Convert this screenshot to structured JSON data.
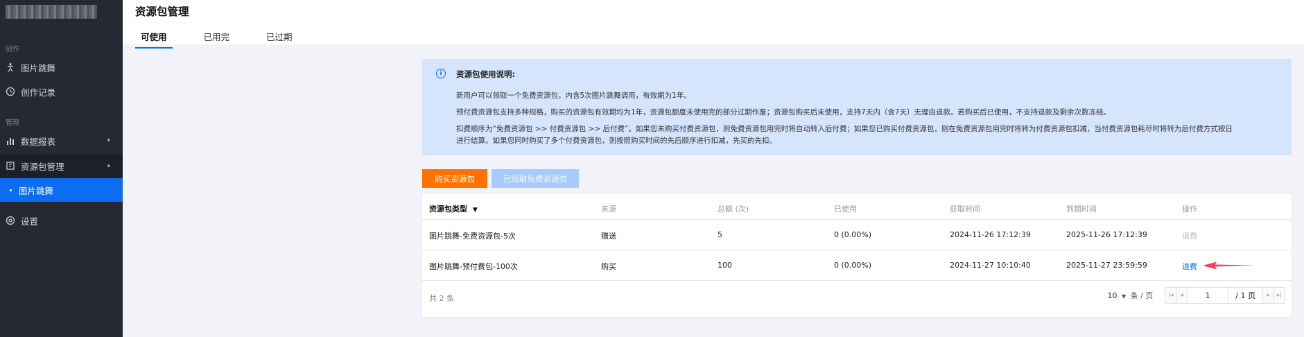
{
  "sidebar": {
    "groups": {
      "create": "创作",
      "manage": "管理"
    },
    "items": [
      {
        "label": "图片跳舞"
      },
      {
        "label": "创作记录"
      },
      {
        "label": "数据报表"
      },
      {
        "label": "资源包管理"
      },
      {
        "label": "图片跳舞"
      },
      {
        "label": "设置"
      }
    ]
  },
  "header": {
    "title": "资源包管理",
    "tabs": [
      {
        "label": "可使用"
      },
      {
        "label": "已用完"
      },
      {
        "label": "已过期"
      }
    ]
  },
  "notice": {
    "title": "资源包使用说明:",
    "lines": [
      "新用户可以领取一个免费资源包，内含5次图片跳舞调用，有效期为1年。",
      "预付费资源包支持多种规格，购买的资源包有效期均为1年，资源包额度未使用完的部分过期作废；资源包购买后未使用，支持7天内（含7天）无理由退款。若购买后已使用，不支持退款及剩余次数冻结。",
      "扣费顺序为“免费资源包 >> 付费资源包 >> 后付费”。如果您未购买付费资源包，则免费资源包用完时将自动转入后付费；如果您已购买付费资源包，则在免费资源包用完时将转为付费资源包扣减，当付费资源包耗尽时将转为后付费方式按日",
      "进行结算。如果您同时购买了多个付费资源包，则按照购买时间的先后顺序进行扣减，先买的先扣。"
    ]
  },
  "actions": {
    "buy": "购买资源包",
    "free": "已领取免费资源包"
  },
  "table": {
    "columns": [
      "资源包类型",
      "来源",
      "总额 (次)",
      "已使用",
      "获取时间",
      "到期时间",
      "操作"
    ],
    "rows": [
      {
        "type": "图片跳舞-免费资源包-5次",
        "source": "赠送",
        "total": "5",
        "used": "0 (0.00%)",
        "acquired": "2024-11-26 17:12:39",
        "expires": "2025-11-26 17:12:39",
        "action": "退费"
      },
      {
        "type": "图片跳舞-预付费包-100次",
        "source": "购买",
        "total": "100",
        "used": "0 (0.00%)",
        "acquired": "2024-11-27 10:10:40",
        "expires": "2025-11-27 23:59:59",
        "action": "退费"
      }
    ],
    "total_text": "共 2 条",
    "page_size": "10",
    "page_size_unit": "条 / 页",
    "page_input": "1",
    "page_total": "/ 1 页"
  },
  "colors": {
    "accent": "#0c6cf2",
    "buy_button": "#ff7200",
    "arrow": "#f0405a",
    "sidebar_bg": "#242932"
  }
}
